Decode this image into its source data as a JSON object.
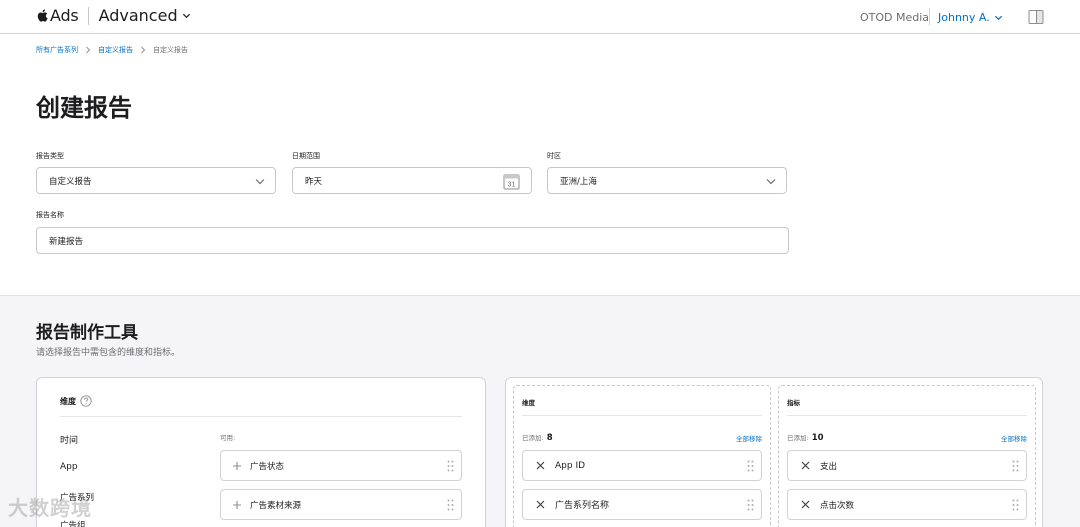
{
  "nav": {
    "brand": "Ads",
    "mode": "Advanced",
    "org": "OTOD Media",
    "user": "Johnny A."
  },
  "breadcrumb": [
    "所有广告系列",
    "自定义报告",
    "自定义报告"
  ],
  "page_title": "创建报告",
  "form": {
    "report_type": {
      "label": "报告类型",
      "value": "自定义报告"
    },
    "date_range": {
      "label": "日期范围",
      "value": "昨天",
      "calendar_day": "31"
    },
    "timezone": {
      "label": "时区",
      "value": "亚洲/上海"
    },
    "report_name": {
      "label": "报告名称",
      "value": "新建报告"
    }
  },
  "builder": {
    "title": "报告制作工具",
    "subtitle": "请选择报告中需包含的维度和指标。",
    "dimensions_panel": {
      "heading": "维度",
      "categories": [
        "时间",
        "App",
        "广告系列",
        "广告组"
      ],
      "available_label": "可用:",
      "available": [
        "广告状态",
        "广告素材来源"
      ]
    },
    "selected_dimensions": {
      "heading": "维度",
      "added_label": "已添加:",
      "count": "8",
      "remove_all": "全部移除",
      "items": [
        "App ID",
        "广告系列名称"
      ]
    },
    "selected_metrics": {
      "heading": "指标",
      "added_label": "已添加:",
      "count": "10",
      "remove_all": "全部移除",
      "items": [
        "支出",
        "点击次数"
      ]
    }
  },
  "watermark": "大数跨境",
  "colors": {
    "accent": "#0070c9",
    "gray_bg": "#f5f5f7",
    "border": "#d2d2d7"
  }
}
